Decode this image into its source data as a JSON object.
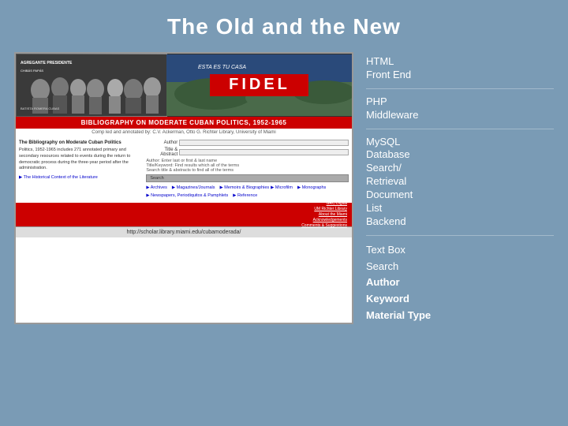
{
  "page": {
    "title": "The Old and the New",
    "background_color": "#7a9bb5"
  },
  "labels": [
    {
      "id": "html-frontend",
      "text": "HTML\nFront End",
      "bold": false
    },
    {
      "id": "php-middleware",
      "text": "PHP\nMiddleware",
      "bold": false
    },
    {
      "id": "mysql-backend",
      "text": "MySQL\nDatabase\nSearch/\nRetrieval\nDocument\nList\nBackend",
      "bold": false
    },
    {
      "id": "textbox-search",
      "text": "Text Box\nSearch\nAuthor\nKeyword\nMaterial Type",
      "mixed": true,
      "normal_lines": [
        "Text Box",
        "Search"
      ],
      "bold_lines": [
        "Author",
        "Keyword",
        "Material Type"
      ]
    }
  ],
  "inner_site": {
    "title_bar": "BIBLIOGRAPHY ON MODERATE CUBAN POLITICS, 1952-1965",
    "subtitle": "Comp led and annotated by: C.V. Ackerman, Otto G. Richter Library, University of Miami",
    "left_panel_title": "The Bibliography on Moderate Cuban Politics",
    "left_panel_text": "Politics, 1952-1965 includes 271 annotated primary and secondary resources related to events during the return to democratic process during the three-year period after the administration.",
    "form_labels": [
      "Author",
      "Title & Abstract"
    ],
    "search_button": "Search",
    "link_rows": [
      [
        "Archives",
        "Magazines/Journals",
        "Memoirs & Biographies"
      ],
      [
        "Microfilm",
        "Monographs"
      ],
      [
        "Newspapers, Periodiquitos & Pamphlets",
        "Reference"
      ]
    ],
    "footer_links": [
      "GRC Digital",
      "UM Richter Library",
      "About the Miami",
      "Acknowledgements",
      "Comments & Suggestions"
    ],
    "url": "http://scholar.library.miami.edu/cubamoderada/"
  }
}
